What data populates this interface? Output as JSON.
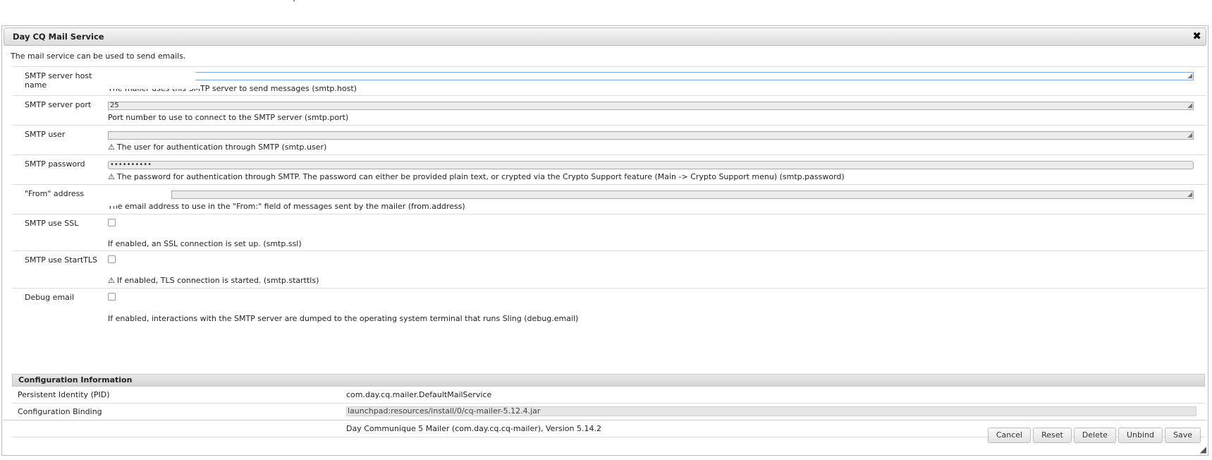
{
  "dialog": {
    "title": "Day CQ Mail Service",
    "close_glyph": "✖",
    "description": "The mail service can be used to send emails."
  },
  "fields": [
    {
      "label": "SMTP server host name",
      "value": "",
      "help": "The mailer uses this SMTP server to send messages (smtp.host)",
      "warning": false,
      "type": "text"
    },
    {
      "label": "SMTP server port",
      "value": "25",
      "help": "Port number to use to connect to the SMTP server (smtp.port)",
      "warning": false,
      "type": "text"
    },
    {
      "label": "SMTP user",
      "value": "",
      "help": "The user for authentication through SMTP (smtp.user)",
      "warning": true,
      "type": "text"
    },
    {
      "label": "SMTP password",
      "value": "••••••••••",
      "help": "The password for authentication through SMTP. The password can either be provided plain text, or crypted via the Crypto Support feature (Main -> Crypto Support menu) (smtp.password)",
      "warning": true,
      "type": "password"
    },
    {
      "label": "\"From\" address",
      "value": "",
      "help": "The email address to use in the \"From:\" field of messages sent by the mailer (from.address)",
      "warning": false,
      "type": "text"
    },
    {
      "label": "SMTP use SSL",
      "checked": false,
      "help": "If enabled, an SSL connection is set up. (smtp.ssl)",
      "warning": false,
      "type": "checkbox"
    },
    {
      "label": "SMTP use StartTLS",
      "checked": false,
      "help": "If enabled, TLS connection is started. (smtp.starttls)",
      "warning": true,
      "type": "checkbox"
    },
    {
      "label": "Debug email",
      "checked": false,
      "help": "If enabled, interactions with the SMTP server are dumped to the operating system terminal that runs Sling (debug.email)",
      "warning": false,
      "type": "checkbox"
    }
  ],
  "config": {
    "heading": "Configuration Information",
    "pid_label": "Persistent Identity (PID)",
    "pid_value": "com.day.cq.mailer.DefaultMailService",
    "binding_label": "Configuration Binding",
    "binding_value": "launchpad:resources/install/0/cq-mailer-5.12.4.jar",
    "bundle_value": "Day Communique 5 Mailer (com.day.cq.cq-mailer), Version 5.14.2"
  },
  "buttons": {
    "cancel": "Cancel",
    "reset": "Reset",
    "delete": "Delete",
    "unbind": "Unbind",
    "save": "Save"
  },
  "icons": {
    "warning": "warning-icon",
    "close": "close-icon",
    "resize": "resize-grip-icon"
  }
}
